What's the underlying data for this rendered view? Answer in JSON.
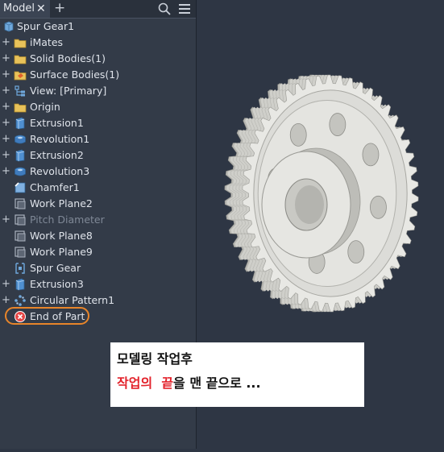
{
  "browser": {
    "tab_label": "Model",
    "root_label": "Spur Gear1",
    "items": [
      {
        "label": "iMates",
        "icon": "folder-icon",
        "expandable": true
      },
      {
        "label": "Solid Bodies(1)",
        "icon": "folder-icon",
        "expandable": true
      },
      {
        "label": "Surface Bodies(1)",
        "icon": "surface-folder-icon",
        "expandable": true
      },
      {
        "label": "View: [Primary]",
        "icon": "view-icon",
        "expandable": true
      },
      {
        "label": "Origin",
        "icon": "folder-icon",
        "expandable": true
      },
      {
        "label": "Extrusion1",
        "icon": "extrusion-icon",
        "expandable": true
      },
      {
        "label": "Revolution1",
        "icon": "revolution-icon",
        "expandable": true
      },
      {
        "label": "Extrusion2",
        "icon": "extrusion-icon",
        "expandable": true
      },
      {
        "label": "Revolution3",
        "icon": "revolution-icon",
        "expandable": true
      },
      {
        "label": "Chamfer1",
        "icon": "chamfer-icon",
        "expandable": false
      },
      {
        "label": "Work Plane2",
        "icon": "work-plane-icon",
        "expandable": false
      },
      {
        "label": "Pitch Diameter",
        "icon": "work-plane-icon",
        "expandable": true,
        "dimmed": true
      },
      {
        "label": "Work Plane8",
        "icon": "work-plane-icon",
        "expandable": false
      },
      {
        "label": "Work Plane9",
        "icon": "work-plane-icon",
        "expandable": false
      },
      {
        "label": "Spur Gear",
        "icon": "spur-gear-icon",
        "expandable": false
      },
      {
        "label": "Extrusion3",
        "icon": "extrusion-icon",
        "expandable": true
      },
      {
        "label": "Circular Pattern1",
        "icon": "circular-pattern-icon",
        "expandable": true
      },
      {
        "label": "End of Part",
        "icon": "end-of-part-icon",
        "expandable": false,
        "highlighted": true
      }
    ]
  },
  "note": {
    "line1": "모델링 작업후",
    "line2_red_a": "작업의",
    "line2_red_b": "끝",
    "line2_rest": "을 맨 끝으로 ..."
  },
  "colors": {
    "panel_bg": "#333b48",
    "viewport_bg": "#2e3644",
    "highlight_ring": "#e8852a",
    "note_red": "#e3232c",
    "gear": "#e2e2de"
  }
}
